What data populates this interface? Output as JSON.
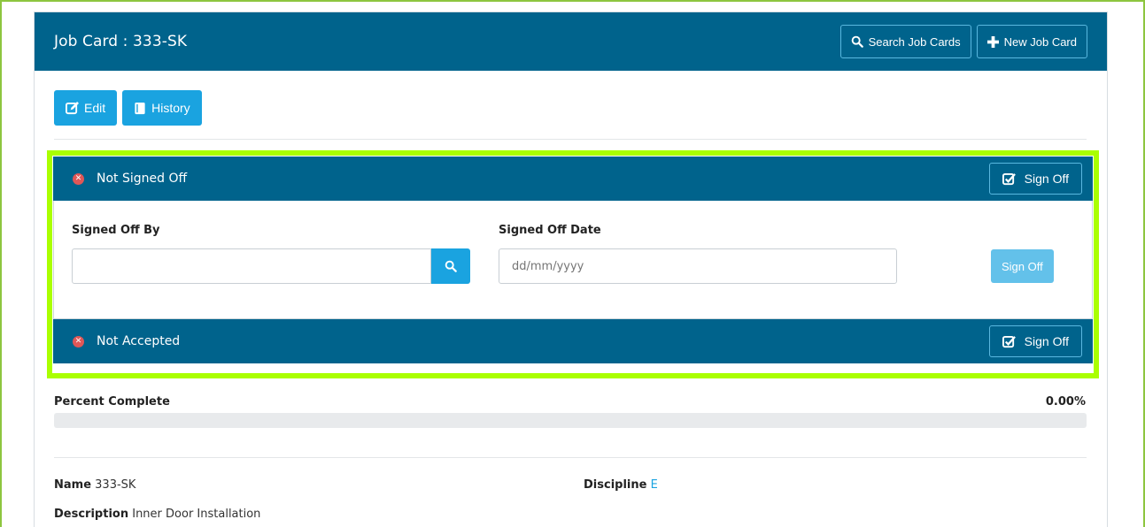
{
  "header": {
    "title": "Job Card : 333-SK",
    "search_label": "Search Job Cards",
    "new_label": "New Job Card"
  },
  "toolbar": {
    "edit_label": "Edit",
    "history_label": "History"
  },
  "signoff": {
    "status": "Not Signed Off",
    "button_label": "Sign Off",
    "signed_by_label": "Signed Off By",
    "signed_by_value": "",
    "signed_date_label": "Signed Off Date",
    "signed_date_placeholder": "dd/mm/yyyy",
    "submit_label": "Sign Off"
  },
  "acceptance": {
    "status": "Not Accepted",
    "button_label": "Sign Off"
  },
  "progress": {
    "label": "Percent Complete",
    "value_text": "0.00%",
    "fraction": 0.0
  },
  "details": {
    "name_label": "Name",
    "name_value": "333-SK",
    "discipline_label": "Discipline",
    "discipline_value": "E",
    "description_label": "Description",
    "description_value": "Inner Door Installation"
  },
  "colors": {
    "primary": "#00638c",
    "accent": "#1aa3e0",
    "highlight": "#aaff00",
    "danger": "#e05757"
  }
}
